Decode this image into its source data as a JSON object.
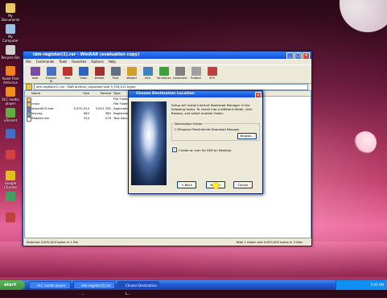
{
  "desktop": {
    "icons": [
      {
        "label": "My Documents",
        "icon": "folder-icon",
        "color": "#e8c860"
      },
      {
        "label": "My Computer",
        "icon": "computer-icon",
        "color": "#9ac0e8"
      },
      {
        "label": "Recycle Bin",
        "icon": "recycle-bin-icon",
        "color": "#d0d0d0"
      },
      {
        "label": "Avast Free Antivirus",
        "icon": "avast-icon",
        "color": "#f08020"
      },
      {
        "label": "VLC media player",
        "icon": "vlc-icon",
        "color": "#f0901a"
      },
      {
        "label": "uTorrent",
        "icon": "utorrent-icon",
        "color": "#60b040"
      },
      {
        "label": "",
        "icon": "app-icon",
        "color": "#4070c0"
      },
      {
        "label": "",
        "icon": "app-icon",
        "color": "#d04040"
      },
      {
        "label": "Google Chrome",
        "icon": "chrome-icon",
        "color": "#e0c020"
      },
      {
        "label": "",
        "icon": "app-icon",
        "color": "#40a060"
      },
      {
        "label": "",
        "icon": "app-icon",
        "color": "#c04040"
      }
    ]
  },
  "winrar": {
    "title": "idm-register(1).rar - WinRAR (evaluation copy)",
    "menu": [
      "File",
      "Commands",
      "Tools",
      "Favorites",
      "Options",
      "Help"
    ],
    "toolbar": [
      {
        "label": "Add",
        "icon": "add-icon",
        "color": "#7a4ca0"
      },
      {
        "label": "Extract To",
        "icon": "extract-icon",
        "color": "#4a70c0"
      },
      {
        "label": "Test",
        "icon": "test-icon",
        "color": "#c03030"
      },
      {
        "label": "View",
        "icon": "view-icon",
        "color": "#3060c0"
      },
      {
        "label": "Delete",
        "icon": "delete-icon",
        "color": "#a03030"
      },
      {
        "label": "Find",
        "icon": "find-icon",
        "color": "#607080"
      },
      {
        "label": "Wizard",
        "icon": "wizard-icon",
        "color": "#d0a020"
      },
      {
        "label": "Info",
        "icon": "info-icon",
        "color": "#4080c0"
      },
      {
        "label": "VirusScan",
        "icon": "virusscan-icon",
        "color": "#40a040"
      },
      {
        "label": "Comment",
        "icon": "comment-icon",
        "color": "#808080"
      },
      {
        "label": "Protect",
        "icon": "protect-icon",
        "color": "#a0a0a0"
      },
      {
        "label": "SFX",
        "icon": "sfx-icon",
        "color": "#c04040"
      }
    ],
    "path": "idm-register(1).rar - RAR archive, unpacked size 5,709,512 bytes",
    "columns": [
      "Name",
      "Size",
      "Packed",
      "Type",
      "Modified"
    ],
    "rows": [
      {
        "name": "..",
        "size": "",
        "packed": "",
        "type": "File Folder",
        "modified": ""
      },
      {
        "name": "crack",
        "size": "",
        "packed": "",
        "type": "File Folder",
        "modified": ""
      },
      {
        "name": "idman615.exe",
        "size": "5,670,024",
        "packed": "5,611,762",
        "type": "Application",
        "modified": ""
      },
      {
        "name": "key.reg",
        "size": "962",
        "packed": "385",
        "type": "Registration Entries",
        "modified": ""
      },
      {
        "name": "Readme.txt",
        "size": "314",
        "packed": "279",
        "type": "Text Document",
        "modified": ""
      }
    ],
    "status_left": "Selected 5,670,024 bytes in 1 file",
    "status_right": "Total 1 folder and 5,670,050 bytes in 3 files"
  },
  "dialog": {
    "title": "Choose Destination Location",
    "text": "Setup will install Internet Download Manager in the following folder. To install into a different folder, click Browse, and select another folder.",
    "dest_label": "Destination Folder",
    "dest_path": "C:\\Program Files\\Internet Download Manager",
    "browse": "Browse...",
    "checkbox": "Create an icon for IDM on Desktop",
    "back": "< Back",
    "next": "Next >",
    "cancel": "Cancel"
  },
  "taskbar": {
    "start": "start",
    "tasks": [
      "VLC media player",
      "idm-register(1).rar ...",
      "Choose Destination L..."
    ],
    "clock": "5:05 AM"
  }
}
